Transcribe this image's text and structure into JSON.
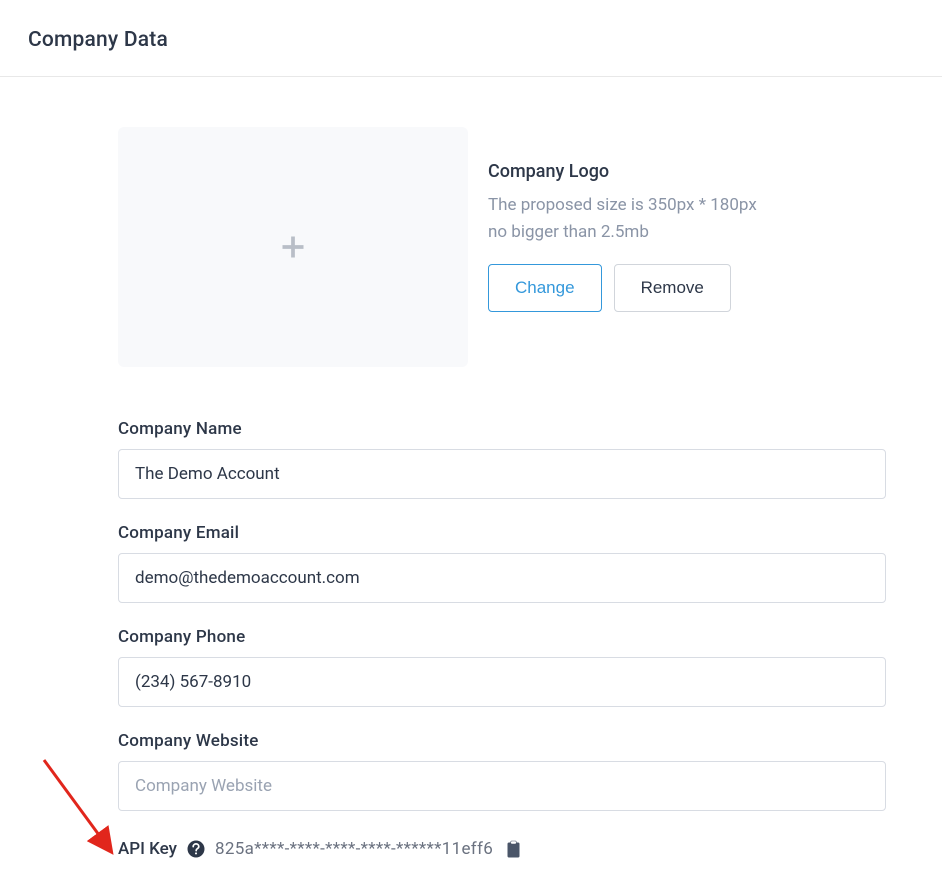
{
  "header": {
    "title": "Company Data"
  },
  "logo": {
    "title": "Company Logo",
    "desc_line1": "The proposed size is 350px * 180px",
    "desc_line2": "no bigger than 2.5mb",
    "change_label": "Change",
    "remove_label": "Remove"
  },
  "fields": {
    "name": {
      "label": "Company Name",
      "value": "The Demo Account"
    },
    "email": {
      "label": "Company Email",
      "value": "demo@thedemoaccount.com"
    },
    "phone": {
      "label": "Company Phone",
      "value": "(234) 567-8910"
    },
    "website": {
      "label": "Company Website",
      "value": "",
      "placeholder": "Company Website"
    }
  },
  "api": {
    "label": "API Key",
    "value": "825a****-****-****-****-******11eff6"
  }
}
